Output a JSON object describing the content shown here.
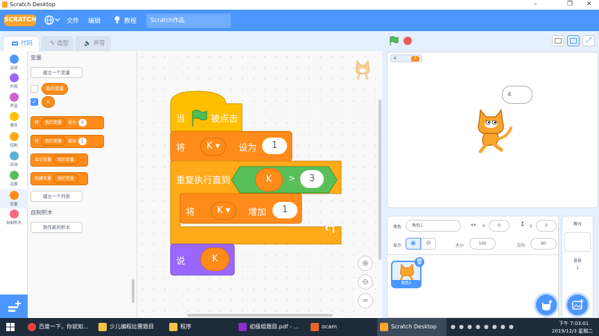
{
  "window": {
    "title": "Scratch Desktop",
    "minimize": "–",
    "maximize": "❐",
    "close": "✕"
  },
  "menubar": {
    "logo": "SCRATCH",
    "language_icon": "globe-icon",
    "file": "文件",
    "edit": "编辑",
    "tutorials": "教程",
    "project_name": "Scratch作品"
  },
  "tabs": [
    {
      "label": "代码",
      "icon": "code-icon"
    },
    {
      "label": "造型",
      "icon": "brush-icon"
    },
    {
      "label": "声音",
      "icon": "speaker-icon"
    }
  ],
  "categories": [
    {
      "label": "运动",
      "color": "#4c97ff"
    },
    {
      "label": "外观",
      "color": "#9966ff"
    },
    {
      "label": "声音",
      "color": "#cf63cf"
    },
    {
      "label": "事件",
      "color": "#ffbf00"
    },
    {
      "label": "控制",
      "color": "#ffab19"
    },
    {
      "label": "侦测",
      "color": "#5cb1d6"
    },
    {
      "label": "运算",
      "color": "#59c059"
    },
    {
      "label": "变量",
      "color": "#ff8c1a"
    },
    {
      "label": "自制积木",
      "color": "#ff6680"
    }
  ],
  "palette": {
    "variables_header": "变量",
    "make_variable": "建立一个变量",
    "var1": "我的变量",
    "var2": "K",
    "set_block": {
      "prefix": "将",
      "var": "我的变量",
      "op": "设为",
      "value": "0"
    },
    "change_block": {
      "prefix": "将",
      "var": "我的变量",
      "op": "增加",
      "value": "1"
    },
    "show_block": {
      "prefix": "显示变量",
      "var": "我的变量"
    },
    "hide_block": {
      "prefix": "隐藏变量",
      "var": "我的变量"
    },
    "make_list": "建立一个列表",
    "myblocks_header": "自制积木",
    "make_block": "制作新的积木"
  },
  "script": {
    "when_flag": {
      "left": "当",
      "right": "被点击"
    },
    "set": {
      "prefix": "将",
      "var": "K",
      "op": "设为",
      "value": "1"
    },
    "repeat_until": {
      "label": "重复执行直到",
      "lhs": "K",
      "op": ">",
      "rhs": "3"
    },
    "change": {
      "prefix": "将",
      "var": "K",
      "op": "增加",
      "value": "1"
    },
    "say": {
      "label": "说",
      "value": "K"
    }
  },
  "stage": {
    "monitor_label": "K",
    "monitor_value": "4",
    "bubble_text": "4"
  },
  "sprite_info": {
    "sprite_label": "角色",
    "sprite_name": "角色1",
    "x_label": "x",
    "x_value": "0",
    "y_label": "y",
    "y_value": "0",
    "show_label": "显示",
    "size_label": "大小",
    "size_value": "100",
    "direction_label": "方向",
    "direction_value": "90"
  },
  "sprite_thumb": {
    "name": "角色1"
  },
  "backdrop": {
    "header": "舞台",
    "label": "背景",
    "count": "1"
  },
  "taskbar": {
    "items": [
      {
        "label": "百度一下，你就知...",
        "color": "#e94235"
      },
      {
        "label": "少儿编程比赛题目",
        "color": "#f4c542"
      },
      {
        "label": "程序",
        "color": "#f4c542"
      },
      {
        "label": "初级组题目.pdf - ...",
        "color": "#8b2fc9"
      },
      {
        "label": "ocam",
        "color": "#e8642a"
      },
      {
        "label": "Scratch Desktop",
        "color": "#f9a42a"
      }
    ],
    "time": "下午 7:03:01",
    "date": "2019/12/3 星期二"
  }
}
